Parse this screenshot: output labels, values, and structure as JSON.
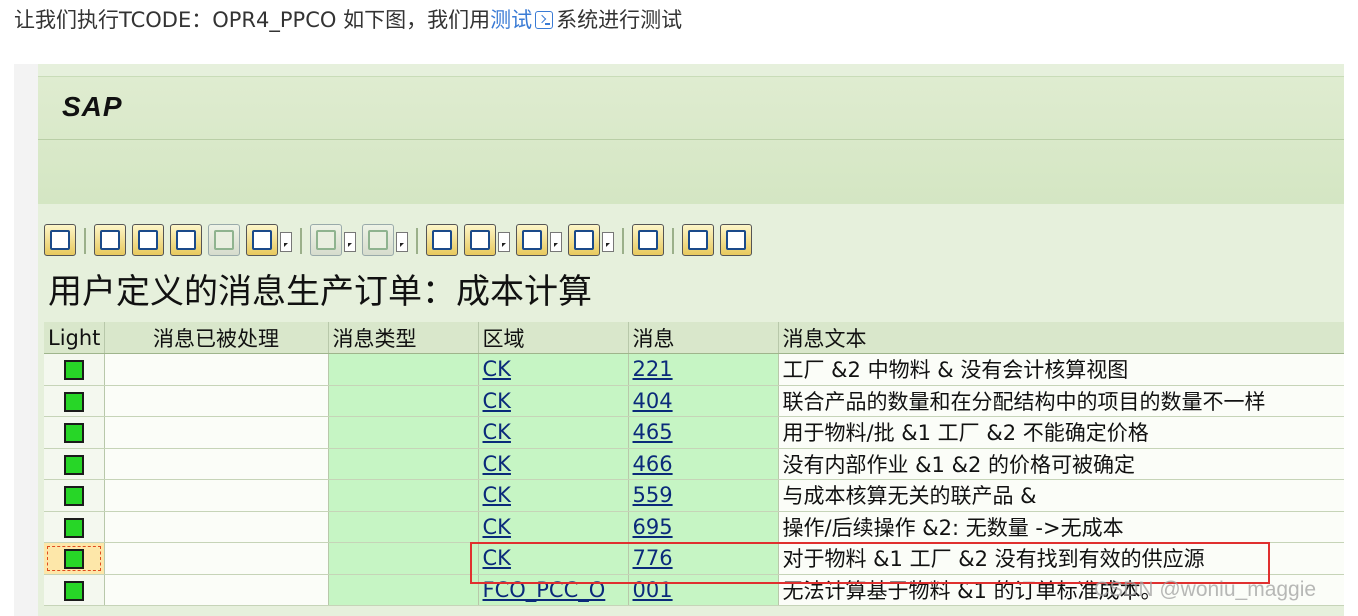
{
  "intro": {
    "prefix": "让我们执行TCODE：OPR4_PPCO 如下图，我们用",
    "link": "测试",
    "link_icon": "terminal-icon",
    "suffix": "系统进行测试"
  },
  "sap": {
    "logo": "SAP",
    "title": "用户定义的消息生产订单：成本计算",
    "toolbar": [
      {
        "icon": "details-icon",
        "disabled": false
      },
      {
        "icon": "sort-ascending-icon",
        "disabled": false
      },
      {
        "icon": "sort-descending-icon",
        "disabled": false
      },
      {
        "icon": "find-icon",
        "disabled": false
      },
      {
        "icon": "find-next-icon",
        "disabled": true
      },
      {
        "icon": "filter-icon",
        "disabled": false,
        "dropdown": true
      },
      {
        "icon": "sum-icon",
        "disabled": true,
        "dropdown": true
      },
      {
        "icon": "subtotal-icon",
        "disabled": true,
        "dropdown": true
      },
      {
        "icon": "print-preview-icon",
        "disabled": false
      },
      {
        "icon": "views-icon",
        "disabled": false,
        "dropdown": true
      },
      {
        "icon": "export-icon",
        "disabled": false,
        "dropdown": true
      },
      {
        "icon": "layout-icon",
        "disabled": false,
        "dropdown": true
      },
      {
        "icon": "info-icon",
        "disabled": false
      },
      {
        "icon": "create-icon",
        "disabled": false
      },
      {
        "icon": "copy-icon",
        "disabled": false
      }
    ],
    "columns": [
      "Light",
      "消息已被处理",
      "消息类型",
      "区域",
      "消息",
      "消息文本"
    ],
    "rows": [
      {
        "area": "CK",
        "msg": "221",
        "text": "工厂 &2 中物料 & 没有会计核算视图"
      },
      {
        "area": "CK",
        "msg": "404",
        "text": "联合产品的数量和在分配结构中的项目的数量不一样"
      },
      {
        "area": "CK",
        "msg": "465",
        "text": "用于物料/批 &1 工厂 &2 不能确定价格"
      },
      {
        "area": "CK",
        "msg": "466",
        "text": "没有内部作业 &1 &2 的价格可被确定"
      },
      {
        "area": "CK",
        "msg": "559",
        "text": "与成本核算无关的联产品 &"
      },
      {
        "area": "CK",
        "msg": "695",
        "text": "操作/后续操作 &2: 无数量 ->无成本"
      },
      {
        "area": "CK",
        "msg": "776",
        "text": "对于物料 &1 工厂 &2 没有找到有效的供应源",
        "selected": true
      },
      {
        "area": "FCO_PCC_O",
        "msg": "001",
        "text": "无法计算基于物料 &1 的订单标准成本。"
      }
    ],
    "light_color": "#27d627"
  },
  "watermark": "CSDN @woniu_maggie"
}
